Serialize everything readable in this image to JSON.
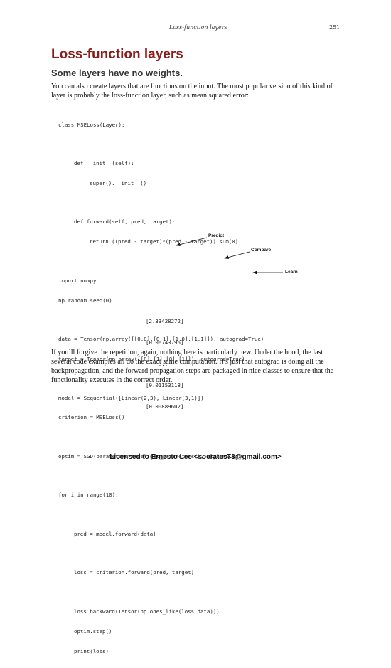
{
  "header": {
    "running_title": "Loss-function layers",
    "page_number": "251"
  },
  "section": {
    "title": "Loss-function layers",
    "subheading": "Some layers have no weights."
  },
  "intro_paragraph": "You can also create layers that are functions on the input. The most popular version of this kind of layer is probably the loss-function layer, such as mean squared error:",
  "code": {
    "class_def": "class MSELoss(Layer):",
    "init_def": "def __init__(self):",
    "init_body": "super().__init__()",
    "forward_def": "def forward(self, pred, target):",
    "forward_body": "return ((pred - target)*(pred - target)).sum(0)",
    "import_line": "import numpy",
    "seed_line": "np.random.seed(0)",
    "data_line": "data = Tensor(np.array([[0,0],[0,1],[1,0],[1,1]]), autograd=True)",
    "target_line": "target = Tensor(np.array([[0],[1],[0],[1]]), autograd=True)",
    "model_line": "model = Sequential([Linear(2,3), Linear(3,1)])",
    "criterion_line": "criterion = MSELoss()",
    "optim_line": "optim = SGD(parameters=model.get_parameters(), alpha=0.05)",
    "for_line": "for i in range(10):",
    "pred_line": "pred = model.forward(data)",
    "loss_line": "loss = criterion.forward(pred, target)",
    "backward_line": "loss.backward(Tensor(np.ones_like(loss.data)))",
    "step_line": "optim.step()",
    "print_line": "print(loss)"
  },
  "annotations": {
    "predict": "Predict",
    "compare": "Compare",
    "learn": "Learn"
  },
  "output": [
    "[2.33428272]",
    "[0.06743796]",
    "    ...",
    "[0.01153118]",
    "[0.00889602]"
  ],
  "outro_paragraph": "If you’ll forgive the repetition, again, nothing here is particularly new. Under the hood, the last several code examples all do the exact same computation. It’s just that autograd is doing all the backpropagation, and the forward propagation steps are packaged in nice classes to ensure that the functionality executes in the correct order.",
  "footer": {
    "license": "Licensed to Ernesto Lee <socrates73@gmail.com>"
  }
}
